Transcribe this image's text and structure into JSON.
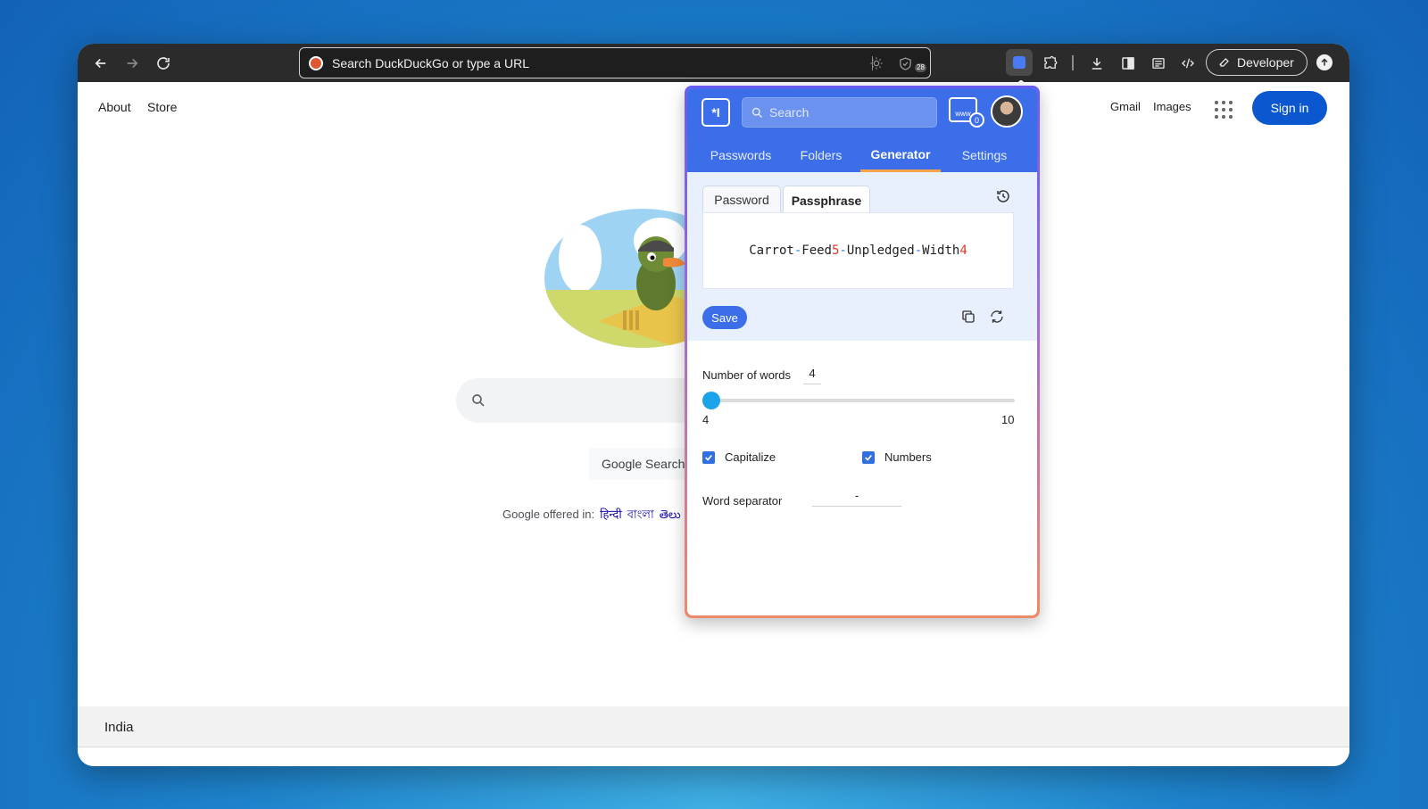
{
  "browser": {
    "omnibox_text": "Search DuckDuckGo or type a URL",
    "shield_badge": "28",
    "developer_label": "Developer"
  },
  "google": {
    "about": "About",
    "store": "Store",
    "gmail": "Gmail",
    "images": "Images",
    "sign_in": "Sign in",
    "search_button": "Google Search",
    "offered_in": "Google offered in:",
    "languages": [
      "हिन्दी",
      "বাংলা",
      "తెలు"
    ],
    "footer_country": "India"
  },
  "popup": {
    "search_placeholder": "Search",
    "site_count": "0",
    "www_label": "www",
    "tabs": [
      "Passwords",
      "Folders",
      "Generator",
      "Settings"
    ],
    "active_tab": "Generator",
    "subtabs": [
      "Password",
      "Passphrase"
    ],
    "active_subtab": "Passphrase",
    "phrase": {
      "parts": [
        "Carrot",
        "-",
        "Feed",
        "5",
        "-",
        "Unpledged",
        "-",
        "Width",
        "4"
      ]
    },
    "save_label": "Save",
    "number_of_words_label": "Number of words",
    "number_of_words": "4",
    "range_min": "4",
    "range_max": "10",
    "slider_fraction": 0,
    "capitalize_label": "Capitalize",
    "numbers_label": "Numbers",
    "capitalize_checked": true,
    "numbers_checked": true,
    "word_separator_label": "Word separator",
    "word_separator": "-"
  },
  "colors": {
    "accent": "#3b6ee8",
    "tab_underline": "#f4a24c",
    "slider": "#1aa3e8",
    "phrase_separator": "#2f7de0",
    "phrase_number": "#e0352b"
  }
}
